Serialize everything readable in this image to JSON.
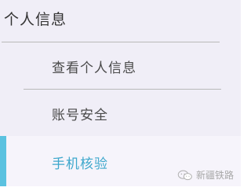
{
  "menu": {
    "title": "个人信息",
    "items": [
      {
        "label": "查看个人信息"
      },
      {
        "label": "账号安全"
      },
      {
        "label": "手机核验",
        "active": true
      }
    ]
  },
  "watermark": {
    "text": "新疆铁路",
    "icon": "wechat-icon"
  },
  "colors": {
    "panel_bg": "#f0eef7",
    "active_bar": "#5bc2e0",
    "active_text": "#3da7cc",
    "divider": "#b9b9b9"
  }
}
